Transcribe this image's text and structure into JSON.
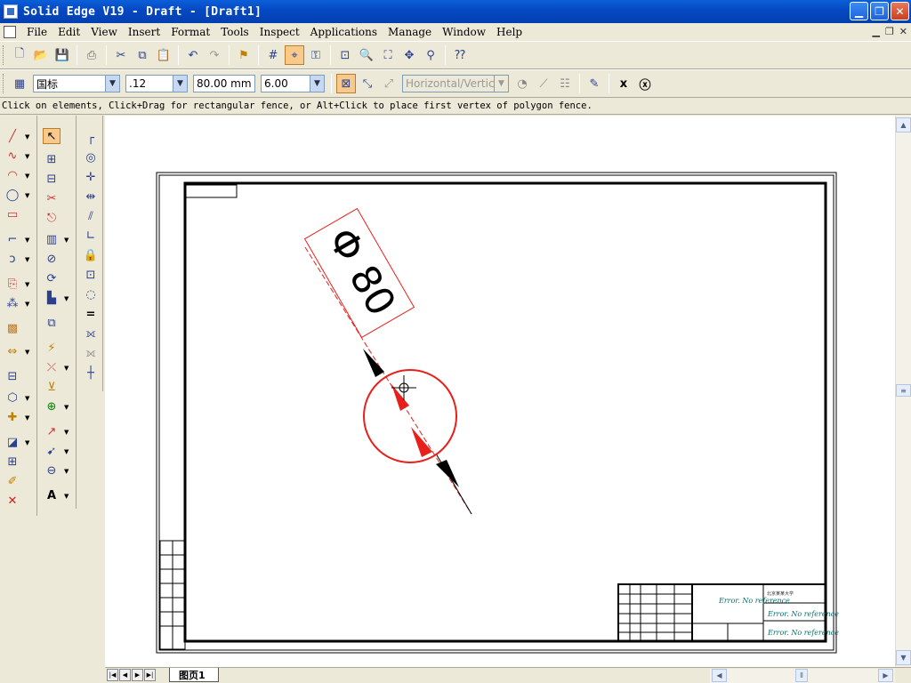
{
  "window": {
    "title": "Solid Edge V19 - Draft - [Draft1]",
    "minimize_icon": "minimize-icon",
    "restore_icon": "restore-icon",
    "close_icon": "close-icon"
  },
  "menu": {
    "items": [
      {
        "label": "File",
        "key": "F"
      },
      {
        "label": "Edit",
        "key": "E"
      },
      {
        "label": "View",
        "key": "V"
      },
      {
        "label": "Insert",
        "key": "I"
      },
      {
        "label": "Format",
        "key": "o"
      },
      {
        "label": "Tools",
        "key": "T"
      },
      {
        "label": "Inspect",
        "key": "s"
      },
      {
        "label": "Applications",
        "key": "A"
      },
      {
        "label": "Manage",
        "key": "M"
      },
      {
        "label": "Window",
        "key": "W"
      },
      {
        "label": "Help",
        "key": "H"
      }
    ]
  },
  "ribbon": {
    "style_value": "国标",
    "precision_value": ".12",
    "diameter_value": "80.00 mm",
    "text_size_value": "6.00",
    "orientation_value": "Horizontal/Vertical"
  },
  "prompt": {
    "text": "Click on elements, Click+Drag for rectangular fence, or Alt+Click to place first vertex of polygon fence."
  },
  "drawing": {
    "dimension_text": "Φ 80",
    "titleblock_error_1": "Error. No reference",
    "titleblock_error_2": "Error. No reference",
    "titleblock_error_3": "Error. No reference",
    "titleblock_small": "北京某某大学",
    "colors": {
      "selection": "#e8201c",
      "line": "#000000"
    }
  },
  "sheets": {
    "active_tab": "图页1"
  }
}
